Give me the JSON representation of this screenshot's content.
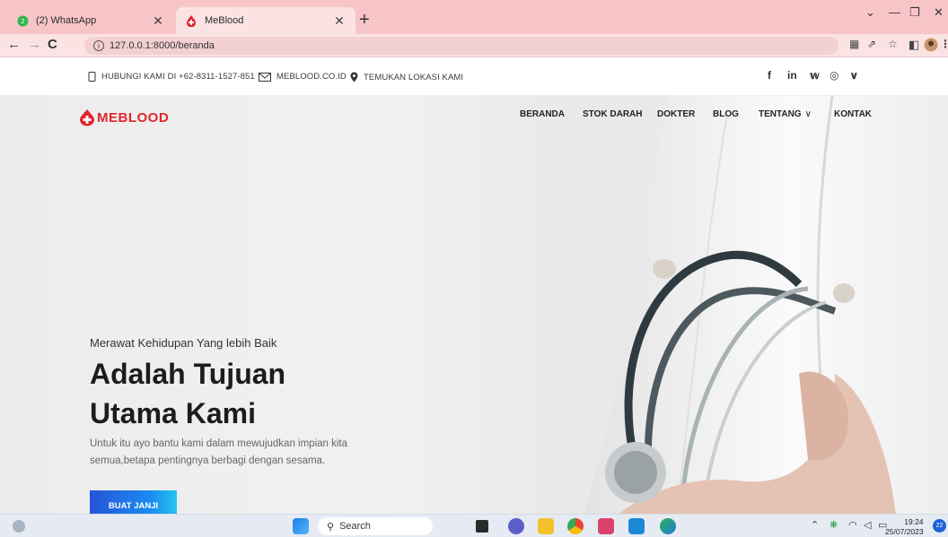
{
  "browser": {
    "tabs": [
      {
        "title": "(2) WhatsApp",
        "active": false
      },
      {
        "title": "MeBlood",
        "active": true
      }
    ],
    "new_tab": "+",
    "url": "127.0.0.1:8000/beranda"
  },
  "topbar": {
    "phone": "HUBUNGI KAMI DI +62-8311-1527-851",
    "email": "MEBLOOD.CO.ID",
    "location": "TEMUKAN LOKASI KAMI",
    "social": [
      "f",
      "in",
      "𝕨",
      "◎",
      "𝐯"
    ]
  },
  "site": {
    "logo": "MEBLOOD",
    "nav": [
      "BERANDA",
      "STOK DARAH",
      "DOKTER",
      "BLOG",
      "TENTANG",
      "KONTAK"
    ],
    "dropdown_chevron": "∨"
  },
  "hero": {
    "subtitle": "Merawat Kehidupan Yang lebih Baik",
    "headline_line1": "Adalah Tujuan",
    "headline_line2": "Utama Kami",
    "description": "Untuk itu ayo bantu kami dalam mewujudkan impian kita semua,betapa pentingnya berbagi dengan sesama.",
    "cta": "BUAT JANJI"
  },
  "taskbar": {
    "search": "Search",
    "time": "19:24",
    "date": "25/07/2023",
    "notifications": "22"
  },
  "colors": {
    "tab_strip": "#f7c5c8",
    "brand_red": "#e0252c",
    "cta_start": "#2454d6",
    "cta_end": "#25c4f2"
  }
}
